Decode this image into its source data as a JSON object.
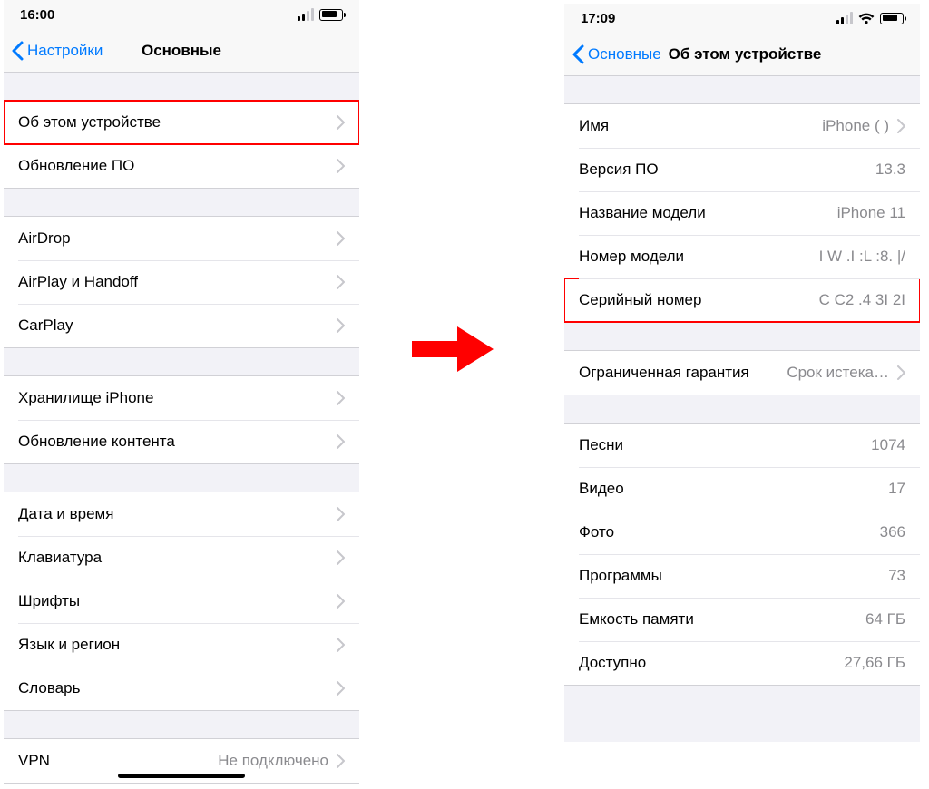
{
  "left": {
    "status": {
      "time": "16:00"
    },
    "nav": {
      "back": "Настройки",
      "title": "Основные"
    },
    "g1": [
      {
        "label": "Об этом устройстве",
        "chev": true,
        "hl": true
      },
      {
        "label": "Обновление ПО",
        "chev": true
      }
    ],
    "g2": [
      {
        "label": "AirDrop",
        "chev": true
      },
      {
        "label": "AirPlay и Handoff",
        "chev": true
      },
      {
        "label": "CarPlay",
        "chev": true
      }
    ],
    "g3": [
      {
        "label": "Хранилище iPhone",
        "chev": true
      },
      {
        "label": "Обновление контента",
        "chev": true
      }
    ],
    "g4": [
      {
        "label": "Дата и время",
        "chev": true
      },
      {
        "label": "Клавиатура",
        "chev": true
      },
      {
        "label": "Шрифты",
        "chev": true
      },
      {
        "label": "Язык и регион",
        "chev": true
      },
      {
        "label": "Словарь",
        "chev": true
      }
    ],
    "g5": [
      {
        "label": "VPN",
        "value": "Не подключено",
        "chev": true
      }
    ]
  },
  "right": {
    "status": {
      "time": "17:09"
    },
    "nav": {
      "back": "Основные",
      "title": "Об этом устройстве"
    },
    "g1": [
      {
        "label": "Имя",
        "value": "iPhone (          )",
        "chev": true
      },
      {
        "label": "Версия ПО",
        "value": "13.3"
      },
      {
        "label": "Название модели",
        "value": "iPhone 11"
      },
      {
        "label": "Номер модели",
        "value": "I   W .I  :L  :8.  |/"
      },
      {
        "label": "Серийный номер",
        "value": "C   C2    .4    3I    2I",
        "hl": true
      }
    ],
    "g2": [
      {
        "label": "Ограниченная гарантия",
        "value": "Срок истека…",
        "chev": true
      }
    ],
    "g3": [
      {
        "label": "Песни",
        "value": "1074"
      },
      {
        "label": "Видео",
        "value": "17"
      },
      {
        "label": "Фото",
        "value": "366"
      },
      {
        "label": "Программы",
        "value": "73"
      },
      {
        "label": "Емкость памяти",
        "value": "64 ГБ"
      },
      {
        "label": "Доступно",
        "value": "27,66 ГБ"
      }
    ]
  }
}
